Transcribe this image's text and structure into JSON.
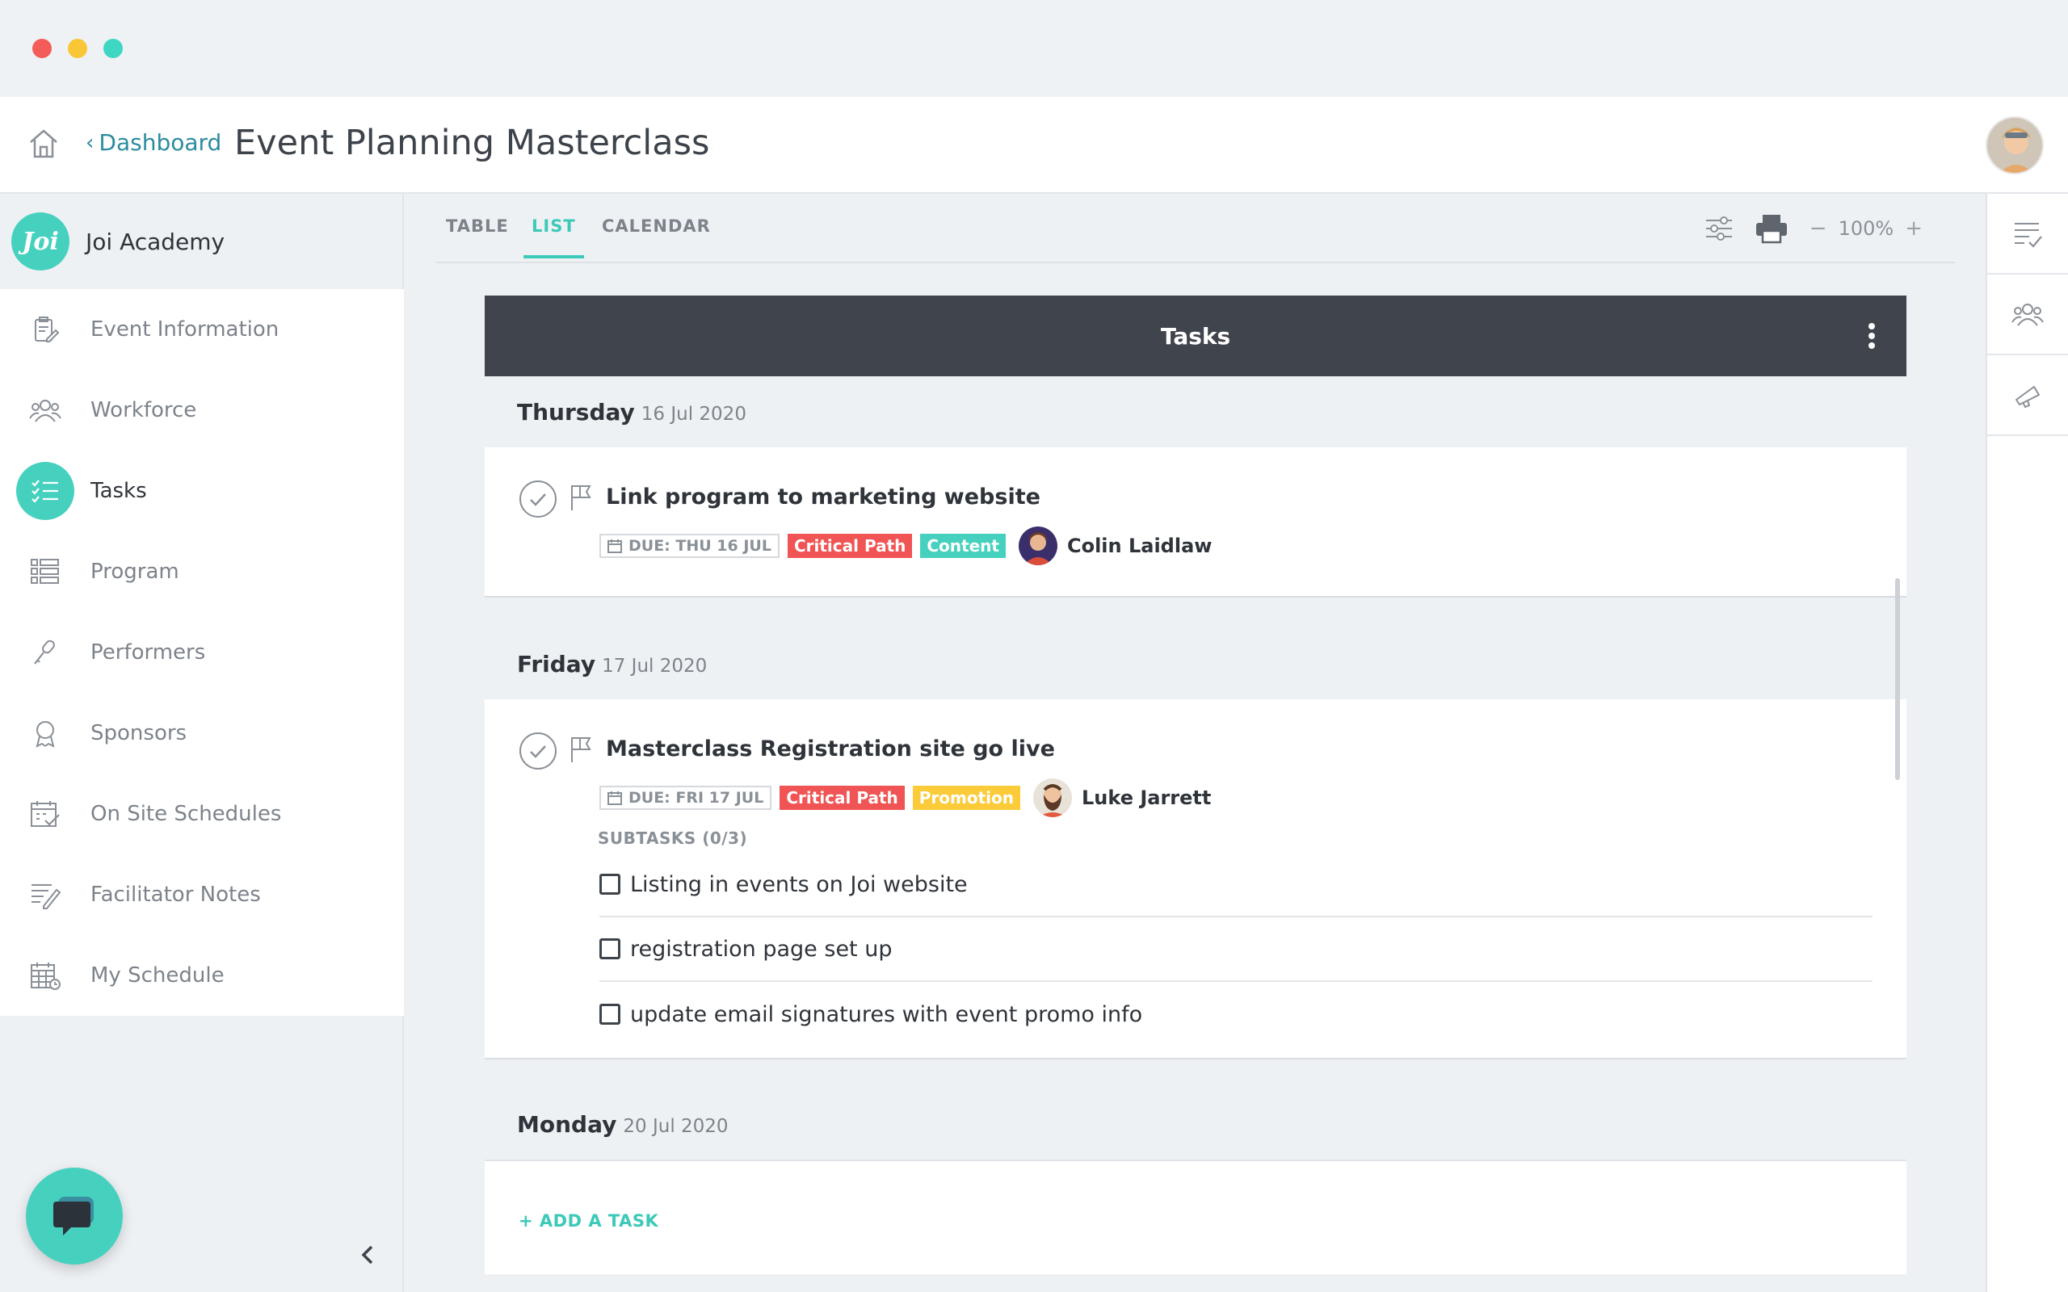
{
  "window": {
    "controls": [
      "close",
      "minimize",
      "maximize"
    ]
  },
  "header": {
    "back_label": "Dashboard",
    "title": "Event Planning Masterclass",
    "home_icon": "home-icon",
    "avatar_icon": "user-avatar"
  },
  "sidebar": {
    "org_logo_text": "Joi",
    "org_name": "Joi Academy",
    "items": [
      {
        "label": "Event Information",
        "icon": "clipboard-edit-icon"
      },
      {
        "label": "Workforce",
        "icon": "people-icon"
      },
      {
        "label": "Tasks",
        "icon": "checklist-icon",
        "active": true
      },
      {
        "label": "Program",
        "icon": "program-list-icon"
      },
      {
        "label": "Performers",
        "icon": "microphone-icon"
      },
      {
        "label": "Sponsors",
        "icon": "award-icon"
      },
      {
        "label": "On Site Schedules",
        "icon": "calendar-check-icon"
      },
      {
        "label": "Facilitator Notes",
        "icon": "notes-pen-icon"
      },
      {
        "label": "My Schedule",
        "icon": "calendar-grid-icon"
      }
    ]
  },
  "main": {
    "tabs": [
      {
        "label": "TABLE"
      },
      {
        "label": "LIST",
        "active": true
      },
      {
        "label": "CALENDAR"
      }
    ],
    "zoom": {
      "minus": "−",
      "value": "100%",
      "plus": "+"
    },
    "panel_title": "Tasks",
    "days": [
      {
        "day": "Thursday",
        "date": "16 Jul 2020",
        "tasks": [
          {
            "title": "Link program to marketing website",
            "due": "DUE: THU 16 JUL",
            "tags": [
              "Critical Path",
              "Content"
            ],
            "assignee": "Colin Laidlaw"
          }
        ]
      },
      {
        "day": "Friday",
        "date": "17 Jul 2020",
        "tasks": [
          {
            "title": "Masterclass Registration site go live",
            "due": "DUE: FRI 17 JUL",
            "tags": [
              "Critical Path",
              "Promotion"
            ],
            "assignee": "Luke Jarrett",
            "subtasks_label": "SUBTASKS (0/3)",
            "subtasks": [
              "Listing in events on Joi website",
              "registration page set up",
              "update email signatures with event promo info"
            ]
          }
        ]
      },
      {
        "day": "Monday",
        "date": "20 Jul 2020",
        "tasks": []
      }
    ],
    "add_task_label": "+ ADD A TASK"
  },
  "colors": {
    "accent": "#46d1bf",
    "link": "#2b8ca0",
    "panel_header": "#40454d",
    "tag_red": "#f05454",
    "tag_yellow": "#fbcb3a"
  }
}
